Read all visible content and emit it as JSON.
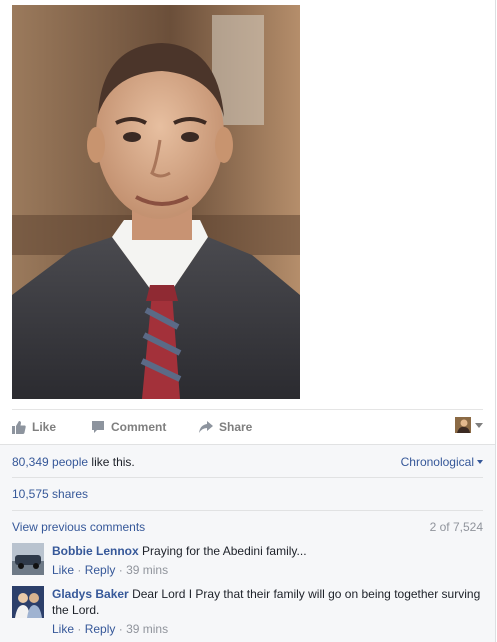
{
  "post": {
    "photo_alt": "",
    "actions": {
      "like": "Like",
      "comment": "Comment",
      "share": "Share"
    }
  },
  "feedback": {
    "like_count": "80,349 people",
    "like_suffix": " like this.",
    "order_label": "Chronological",
    "shares": "10,575 shares",
    "view_previous": "View previous comments",
    "comment_counter": "2 of 7,524",
    "comments": [
      {
        "author": "Bobbie Lennox",
        "text": "Praying for the Abedini family...",
        "like": "Like",
        "reply": "Reply",
        "time": "39 mins",
        "dot": "·"
      },
      {
        "author": "Gladys Baker",
        "text": "Dear Lord I Pray that their family will go on being together surving the Lord.",
        "like": "Like",
        "reply": "Reply",
        "time": "39 mins",
        "dot": "·"
      }
    ]
  },
  "icons": {
    "like": "thumbs-up-icon",
    "comment": "speech-bubble-icon",
    "share": "share-arrow-icon",
    "caret": "caret-down-icon"
  },
  "colors": {
    "link": "#365899",
    "muted": "#90949c",
    "action": "#7f7f7f",
    "feedback_bg": "#f6f7f9"
  }
}
